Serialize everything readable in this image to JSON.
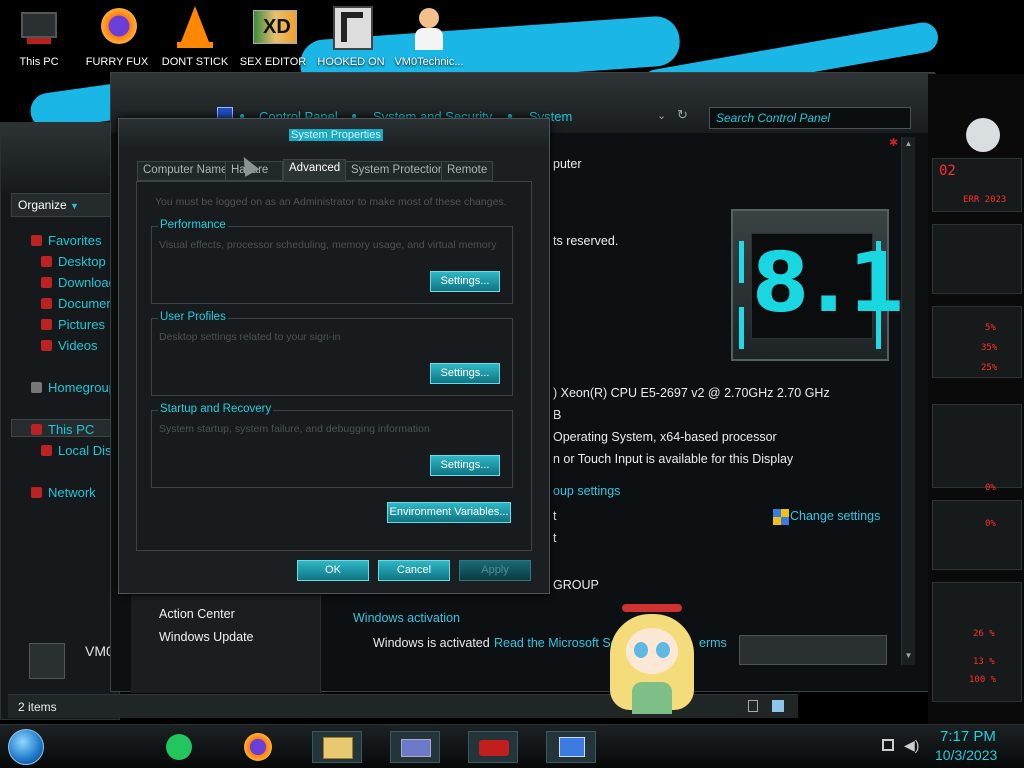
{
  "desktop": {
    "icons": [
      {
        "label": "This PC",
        "icon": "computer-icon"
      },
      {
        "label": "FURRY FUX",
        "icon": "firefox-icon"
      },
      {
        "label": "DONT STICK",
        "icon": "vlc-icon"
      },
      {
        "label": "SEX EDITOR",
        "icon": "hxd-icon"
      },
      {
        "label": "HOOKED ON",
        "icon": "app-icon"
      },
      {
        "label": "VM0Technic...",
        "icon": "doctor-icon"
      }
    ]
  },
  "explorer": {
    "organize_label": "Organize",
    "nav": {
      "favorites": "Favorites",
      "desktop": "Desktop",
      "downloads": "Download",
      "documents": "Documen",
      "pictures": "Pictures",
      "videos": "Videos",
      "homegroup": "Homegroup",
      "this_pc": "This PC",
      "local_disk": "Local Dis",
      "network": "Network"
    },
    "computer_name_partial": "VM0",
    "status_items": "2 items"
  },
  "system_window": {
    "breadcrumb": [
      "Control Panel",
      "System and Security",
      "System"
    ],
    "search_placeholder": "Search Control Panel",
    "partial": {
      "computer": "puter",
      "rights": "ts reserved.",
      "cpu": ") Xeon(R) CPU E5-2697 v2 @ 2.70GHz   2.70 GHz",
      "ram": "B",
      "os_type": " Operating System, x64-based processor",
      "pen": "n or Touch Input is available for this Display",
      "group_settings": "oup settings",
      "line_t1": "t",
      "line_t2": "t",
      "workgroup": "GROUP"
    },
    "change_settings": "Change settings",
    "see_also": {
      "action_center": "Action Center",
      "windows_update": "Windows Update"
    },
    "windows_activation_title": "Windows activation",
    "activated_text": "Windows is activated",
    "license_link_partial": "Read the Microsoft So",
    "terms_partial": "erms",
    "logo_text": "8.1"
  },
  "dialog": {
    "title": "System Properties",
    "tabs": [
      "Computer Name",
      "Ha",
      "are",
      "Advanced",
      "System Protection",
      "Remote"
    ],
    "active_tab": "Advanced",
    "admin_note": "You must be logged on as an Administrator to make most of these changes.",
    "groups": [
      {
        "title": "Performance",
        "desc": "Visual effects, processor scheduling, memory usage, and virtual memory",
        "button": "Settings..."
      },
      {
        "title": "User Profiles",
        "desc": "Desktop settings related to your sign-in",
        "button": "Settings..."
      },
      {
        "title": "Startup and Recovery",
        "desc": "System startup, system failure, and debugging information",
        "button": "Settings..."
      }
    ],
    "env_button": "Environment Variables...",
    "ok": "OK",
    "cancel": "Cancel",
    "apply": "Apply"
  },
  "widgets": {
    "texts": [
      "02",
      "ERR 2023",
      "5%",
      "35%",
      "25%",
      "0%",
      "0%",
      "26 %",
      "13 %",
      "100 %"
    ]
  },
  "taskbar": {
    "apps": [
      "notes-icon",
      "firefox-icon",
      "file-explorer-icon",
      "control-panel-icon",
      "game-icon",
      "system-properties-icon"
    ],
    "time": "7:17 PM",
    "date": "10/3/2023"
  },
  "colors": {
    "accent": "#1cc8d8",
    "alert_red": "#ff2e2e"
  }
}
